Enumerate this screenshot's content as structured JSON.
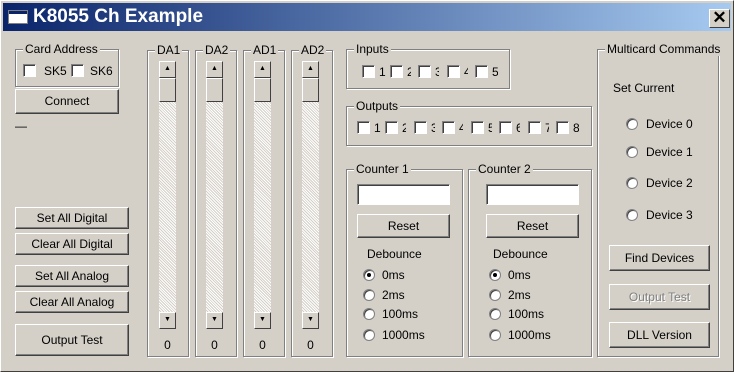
{
  "window": {
    "title": "K8055 Ch Example",
    "close_glyph": "✕"
  },
  "card_address": {
    "label": "Card Address",
    "options": [
      {
        "label": "SK5",
        "checked": false
      },
      {
        "label": "SK6",
        "checked": false
      }
    ],
    "connect_label": "Connect",
    "status_text": "—"
  },
  "left_buttons": {
    "set_all_digital": "Set All Digital",
    "clear_all_digital": "Clear All Digital",
    "set_all_analog": "Set All Analog",
    "clear_all_analog": "Clear All Analog",
    "output_test": "Output Test"
  },
  "sliders": [
    {
      "label": "DA1",
      "value": "0"
    },
    {
      "label": "DA2",
      "value": "0"
    },
    {
      "label": "AD1",
      "value": "0"
    },
    {
      "label": "AD2",
      "value": "0"
    }
  ],
  "inputs": {
    "label": "Inputs",
    "items": [
      "1",
      "2",
      "3",
      "4",
      "5"
    ]
  },
  "outputs": {
    "label": "Outputs",
    "items": [
      "1",
      "2",
      "3",
      "4",
      "5",
      "6",
      "7",
      "8"
    ]
  },
  "counters": [
    {
      "label": "Counter 1",
      "value": "",
      "reset_label": "Reset",
      "debounce_label": "Debounce",
      "options": [
        "0ms",
        "2ms",
        "100ms",
        "1000ms"
      ],
      "selected": "0ms"
    },
    {
      "label": "Counter 2",
      "value": "",
      "reset_label": "Reset",
      "debounce_label": "Debounce",
      "options": [
        "0ms",
        "2ms",
        "100ms",
        "1000ms"
      ],
      "selected": "0ms"
    }
  ],
  "multicard": {
    "label": "Multicard Commands",
    "set_current_label": "Set Current",
    "devices": [
      "Device 0",
      "Device 1",
      "Device 2",
      "Device 3"
    ],
    "selected_device": "",
    "find_devices": "Find Devices",
    "output_test": "Output Test",
    "dll_version": "DLL Version"
  }
}
